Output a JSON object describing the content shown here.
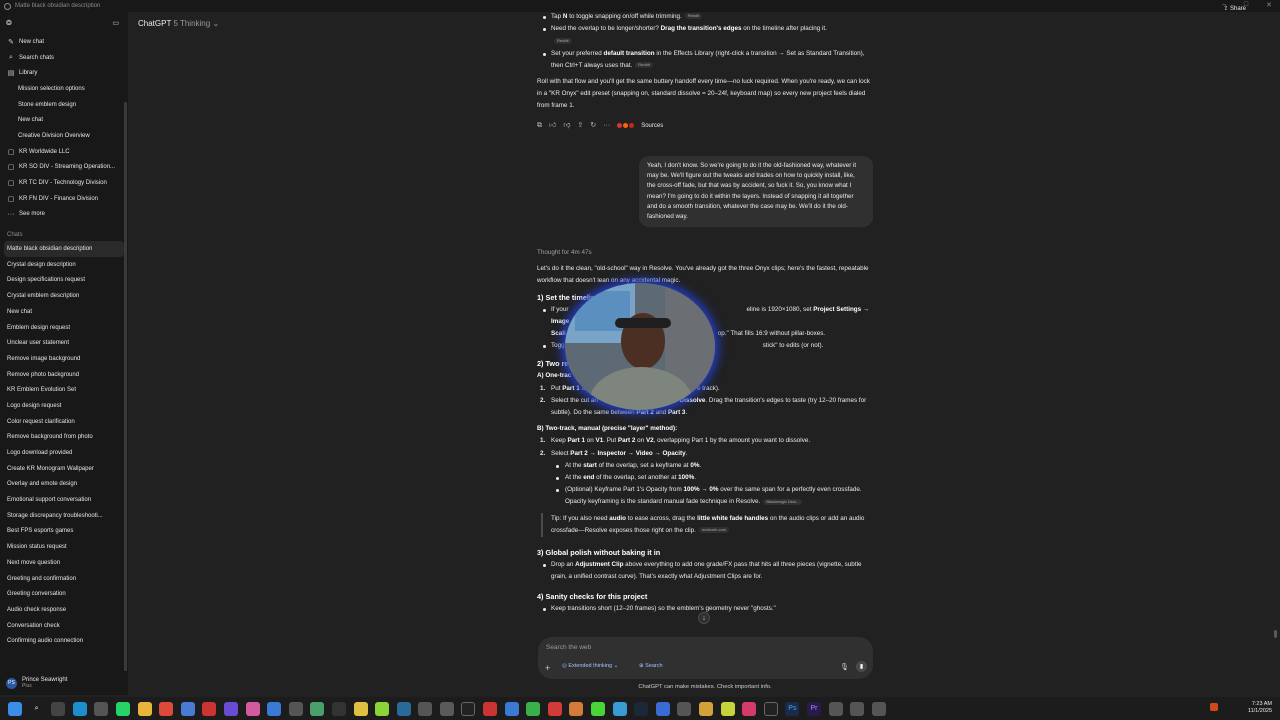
{
  "window": {
    "title": "Matte black obsidian description"
  },
  "header": {
    "model": "ChatGPT",
    "version": "5 Thinking",
    "share_label": "Share"
  },
  "sidebar": {
    "top_items": [
      {
        "label": "New chat",
        "icon": "edit-icon"
      },
      {
        "label": "Search chats",
        "icon": "search-icon"
      },
      {
        "label": "Library",
        "icon": "library-icon"
      }
    ],
    "library_items": [
      "Mission selection options",
      "Stone emblem design",
      "New chat",
      "Creative Division Overview"
    ],
    "projects": [
      "KR Worldwide LLC",
      "KR SO DIV - Streaming Operation...",
      "KR TC DIV - Technology Division",
      "KR FN DIV - Finance Division"
    ],
    "see_more": "See more",
    "chats_heading": "Chats",
    "chats": [
      "Matte black obsidian description",
      "Crystal design description",
      "Design specifications request",
      "Crystal emblem description",
      "New chat",
      "Emblem design request",
      "Unclear user statement",
      "Remove image background",
      "Remove photo background",
      "KR Emblem Evolution Set",
      "Logo design request",
      "Color request clarification",
      "Remove background from photo",
      "Logo download provided",
      "Create KR Monogram Wallpaper",
      "Overlay and emote design",
      "Emotional support conversation",
      "Storage discrepancy troubleshooti...",
      "Best FPS esports games",
      "Mission status request",
      "Next move question",
      "Greeting and confirmation",
      "Greeting conversation",
      "Audio check response",
      "Conversation check",
      "Confirming audio connection"
    ],
    "profile": {
      "initials": "PS",
      "name": "Prince Seawright",
      "plan": "Plus"
    }
  },
  "chat": {
    "top_bullets": [
      {
        "pre": "Tap ",
        "bold": "N",
        "post": " to toggle snapping on/off while trimming.",
        "cite": "Reddit"
      },
      {
        "pre": "Need the overlap to be longer/shorter? ",
        "bold": "Drag the transition's edges",
        "post": " on the timeline after placing it.",
        "cite": "Reddit"
      },
      {
        "pre": "Set your preferred ",
        "bold": "default transition",
        "post": " in the Effects Library (right-click a transition → Set as Standard Transition), then Ctrl+T always uses that.",
        "cite": "Reddit"
      }
    ],
    "closing_para": "Roll with that flow and you'll get the same buttery handoff every time—no luck required. When you're ready, we can lock in a \"KR Onyx\" edit preset (snapping on, standard dissolve = 20–24f, keyboard map) so every new project feels dialed from frame 1.",
    "sources_label": "Sources",
    "user_message": "Yeah, I don't know. So we're going to do it the old-fashioned way, whatever it may be. We'll figure out the tweaks and trades on how to quickly install, like, the cross-off fade, but that was by accident, so fuck it. So, you know what I mean? I'm going to do it within the layers. Instead of snapping it all together and do a smooth transition, whatever the case may be. We'll do it the old-fashioned way.",
    "thought_label": "Thought for 4m 47s",
    "intro": "Let's do it the clean, \"old-school\" way in Resolve. You've already got the three Onyx clips; here's the fastest, repeatable workflow that doesn't lean on any accidental magic.",
    "s1_heading": "1) Set the timeline",
    "s1_b1_pre": "If your",
    "s1_b1_mid": "eline is 1920×1080, set ",
    "s1_b1_bold": "Project Settings → Image",
    "s1_b1_l2a": "Scali",
    "s1_b1_l2b": "op.\" That fills 16:9 without pillar-boxes.",
    "s1_b2a": "Togg",
    "s1_b2b": "stick\" to edits (or not).",
    "s2_heading": "2) Two re",
    "s2a_label": "A) One-trac",
    "a1_pre": "Put ",
    "a1_bold": "Part 1",
    "a1_post": " a",
    "a1_tail": "e track).",
    "a2_pre": "Select the cut an",
    "a2_bold": "Cross Dissolve",
    "a2_post": ". Drag the transition's edges to taste (try 12–20 frames for subtle). Do the same between ",
    "a2_b2": "Part 2",
    "a2_and": " and ",
    "a2_b3": "Part 3",
    "a2_end": ".",
    "s2b_heading": "B) Two-track, manual (precise \"layer\" method):",
    "b1_pre": "Keep ",
    "b1_b1": "Part 1",
    "b1_m1": " on ",
    "b1_b2": "V1",
    "b1_m2": ". Put ",
    "b1_b3": "Part 2",
    "b1_m3": " on ",
    "b1_b4": "V2",
    "b1_end": ", overlapping Part 1 by the amount you want to dissolve.",
    "b2_pre": "Select ",
    "b2_bold": "Part 2 → Inspector → Video → Opacity",
    "b2_end": ".",
    "sub1_pre": "At the ",
    "sub1_bold": "start",
    "sub1_mid": " of the overlap, set a keyframe at ",
    "sub1_val": "0%",
    "sub1_end": ".",
    "sub2_pre": "At the ",
    "sub2_bold": "end",
    "sub2_mid": " of the overlap, set another at ",
    "sub2_val": "100%",
    "sub2_end": ".",
    "sub3_pre": "(Optional) Keyframe Part 1's Opacity from ",
    "sub3_b1": "100% → 0%",
    "sub3_end": " over the same span for a perfectly even crossfade.",
    "sub4": "Opacity keyframing is the standard manual fade technique in Resolve.",
    "sub4_cite": "Blackmagic Desi...",
    "tip_pre": "Tip: If you also need ",
    "tip_b1": "audio",
    "tip_mid": " to ease across, drag the ",
    "tip_b2": "little white fade handles",
    "tip_end": " on the audio clips or add an audio crossfade—Resolve exposes those right on the clip.",
    "tip_cite": "motionrh.com",
    "s3_heading": "3) Global polish without baking it in",
    "s3_pre": "Drop an ",
    "s3_bold": "Adjustment Clip",
    "s3_end": " above everything to add one grade/FX pass that hits all three pieces (vignette, subtle grain, a unified contrast curve). That's exactly what Adjustment Clips are for.",
    "s4_heading": "4) Sanity checks for this project",
    "s4_b1": "Keep transitions short (12–20 frames) so the emblem's geometry never \"ghosts.\""
  },
  "composer": {
    "placeholder": "Search the web",
    "chip1": "Extended thinking",
    "chip2": "Search"
  },
  "disclaimer": "ChatGPT can make mistakes. Check important info.",
  "tray": {
    "time": "7:23 AM",
    "date": "11/1/2025"
  }
}
